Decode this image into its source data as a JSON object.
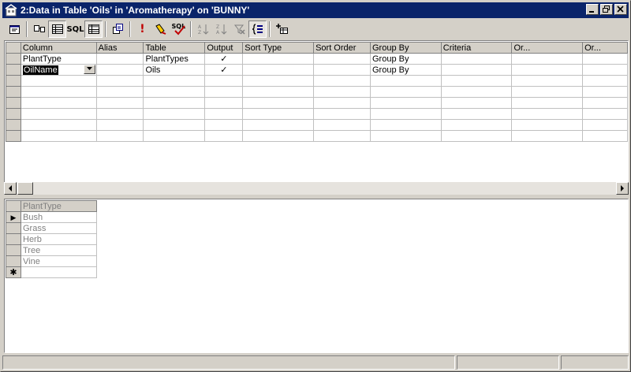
{
  "window": {
    "title": "2:Data in Table 'Oils' in 'Aromatherapy' on 'BUNNY'"
  },
  "toolbar": {
    "buttons": [
      {
        "icon": "properties-icon"
      },
      {
        "icon": "show-diagram-pane-icon"
      },
      {
        "icon": "show-grid-pane-icon",
        "pressed": true
      },
      {
        "icon": "show-sql-pane-icon",
        "label": "SQL"
      },
      {
        "icon": "show-results-pane-icon",
        "pressed": true
      },
      {
        "icon": "change-query-type-icon"
      },
      {
        "icon": "run-icon",
        "label": "!"
      },
      {
        "icon": "clear-results-icon"
      },
      {
        "icon": "verify-sql-icon",
        "label": "SQL"
      },
      {
        "icon": "sort-ascending-icon"
      },
      {
        "icon": "sort-descending-icon"
      },
      {
        "icon": "remove-filter-icon"
      },
      {
        "icon": "group-by-icon",
        "pressed": true
      },
      {
        "icon": "add-table-icon"
      }
    ]
  },
  "query_grid": {
    "columns": [
      "Column",
      "Alias",
      "Table",
      "Output",
      "Sort Type",
      "Sort Order",
      "Group By",
      "Criteria",
      "Or...",
      "Or..."
    ],
    "rows": [
      {
        "column": "PlantType",
        "alias": "",
        "table": "PlantTypes",
        "output": "✓",
        "sort_type": "",
        "sort_order": "",
        "group_by": "Group By",
        "criteria": "",
        "or1": "",
        "or2": ""
      },
      {
        "column": "OilName",
        "alias": "",
        "table": "Oils",
        "output": "✓",
        "sort_type": "",
        "sort_order": "",
        "group_by": "Group By",
        "criteria": "",
        "or1": "",
        "or2": ""
      }
    ]
  },
  "results_grid": {
    "header": "PlantType",
    "rows": [
      "Bush",
      "Grass",
      "Herb",
      "Tree",
      "Vine"
    ],
    "new_row_marker": "✱",
    "current_row_marker": "▶"
  }
}
